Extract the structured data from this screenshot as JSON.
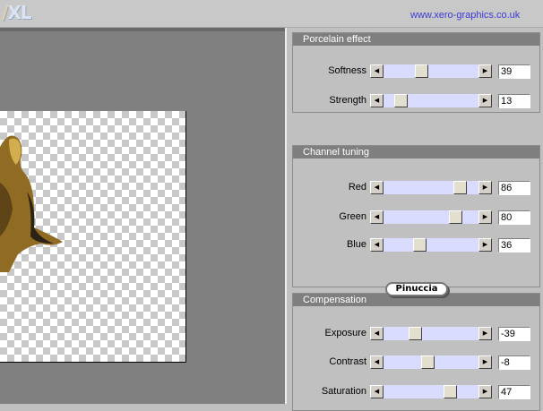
{
  "header": {
    "logo": "XL",
    "logo_prefix": "/",
    "url": "www.xero-graphics.co.uk"
  },
  "watermark": "Pinuccia",
  "colors": {
    "panel_title_bg": "#7f7f7f",
    "slider_track": "#d9dbff",
    "canvas_bg": "#808080"
  },
  "panels": [
    {
      "title": "Porcelain effect",
      "rows": [
        {
          "label": "Softness",
          "value": "39",
          "level": 0.39
        },
        {
          "label": "Strength",
          "value": "13",
          "level": 0.13
        }
      ]
    },
    {
      "title": "Channel tuning",
      "rows": [
        {
          "label": "Red",
          "value": "86",
          "level": 0.86
        },
        {
          "label": "Green",
          "value": "80",
          "level": 0.8
        },
        {
          "label": "Blue",
          "value": "36",
          "level": 0.36
        }
      ]
    },
    {
      "title": "Compensation",
      "rows": [
        {
          "label": "Exposure",
          "value": "-39",
          "level": 0.31
        },
        {
          "label": "Contrast",
          "value": "-8",
          "level": 0.46
        },
        {
          "label": "Saturation",
          "value": "47",
          "level": 0.74
        }
      ]
    }
  ]
}
